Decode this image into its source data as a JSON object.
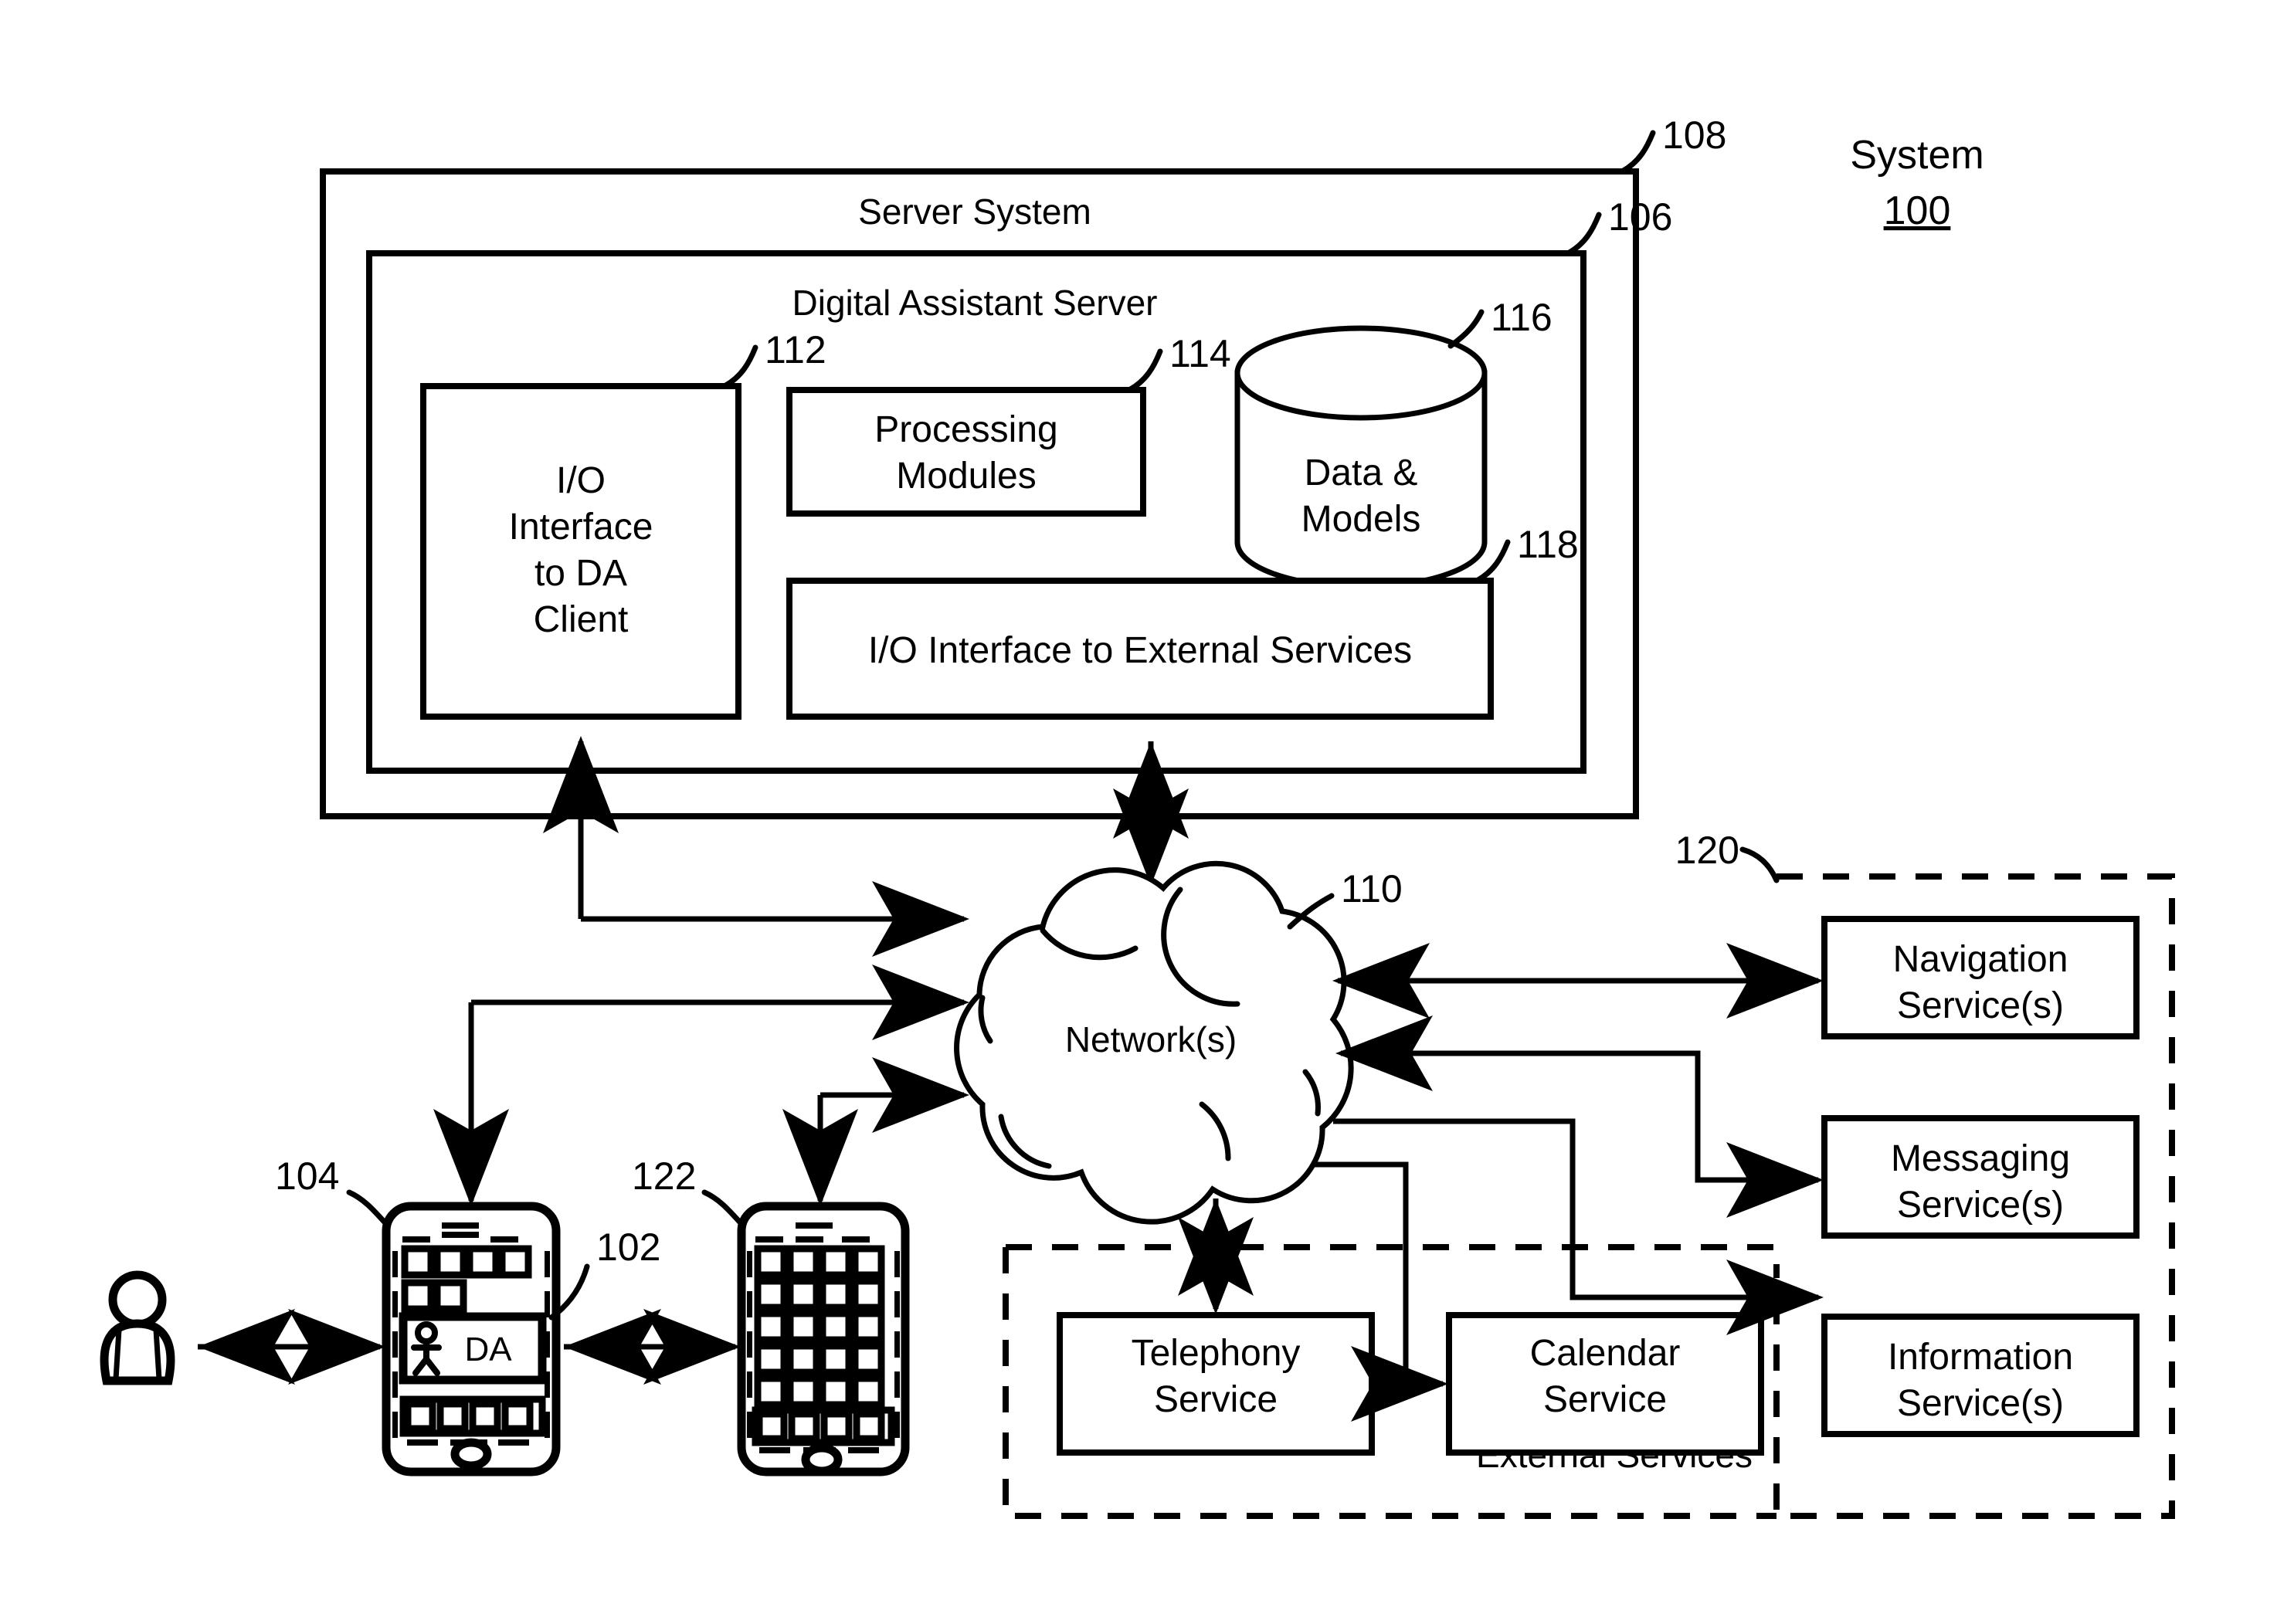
{
  "diagram": {
    "system_label": "System",
    "system_number": "100",
    "server_system": {
      "title": "Server System",
      "ref": "108",
      "digital_assistant_server": {
        "title": "Digital Assistant Server",
        "ref": "106",
        "components": [
          {
            "label": "I/O\nInterface\nto DA\nClient",
            "lines": [
              "I/O",
              "Interface",
              "to DA",
              "Client"
            ],
            "ref": "112"
          },
          {
            "label": "Processing Modules",
            "lines": [
              "Processing",
              "Modules"
            ],
            "ref": "114"
          },
          {
            "label": "Data & Models",
            "lines": [
              "Data &",
              "Models"
            ],
            "ref": "116"
          },
          {
            "label": "I/O Interface to External Services",
            "lines": [
              "I/O Interface to External Services"
            ],
            "ref": "118"
          }
        ]
      }
    },
    "network": {
      "label": "Network(s)",
      "ref": "110"
    },
    "devices": [
      {
        "name": "user-device-primary",
        "ref": "104",
        "app_label": "DA",
        "app_ref": "102"
      },
      {
        "name": "user-device-secondary",
        "ref": "122"
      }
    ],
    "user": {
      "name": "user"
    },
    "external_services_group": {
      "ref": "120",
      "label": "External Services",
      "right_services": [
        {
          "lines": [
            "Navigation",
            "Service(s)"
          ]
        },
        {
          "lines": [
            "Messaging",
            "Service(s)"
          ]
        },
        {
          "lines": [
            "Information",
            "Service(s)"
          ]
        }
      ],
      "bottom_services": [
        {
          "lines": [
            "Telephony",
            "Service"
          ]
        },
        {
          "lines": [
            "Calendar",
            "Service"
          ]
        }
      ]
    }
  }
}
